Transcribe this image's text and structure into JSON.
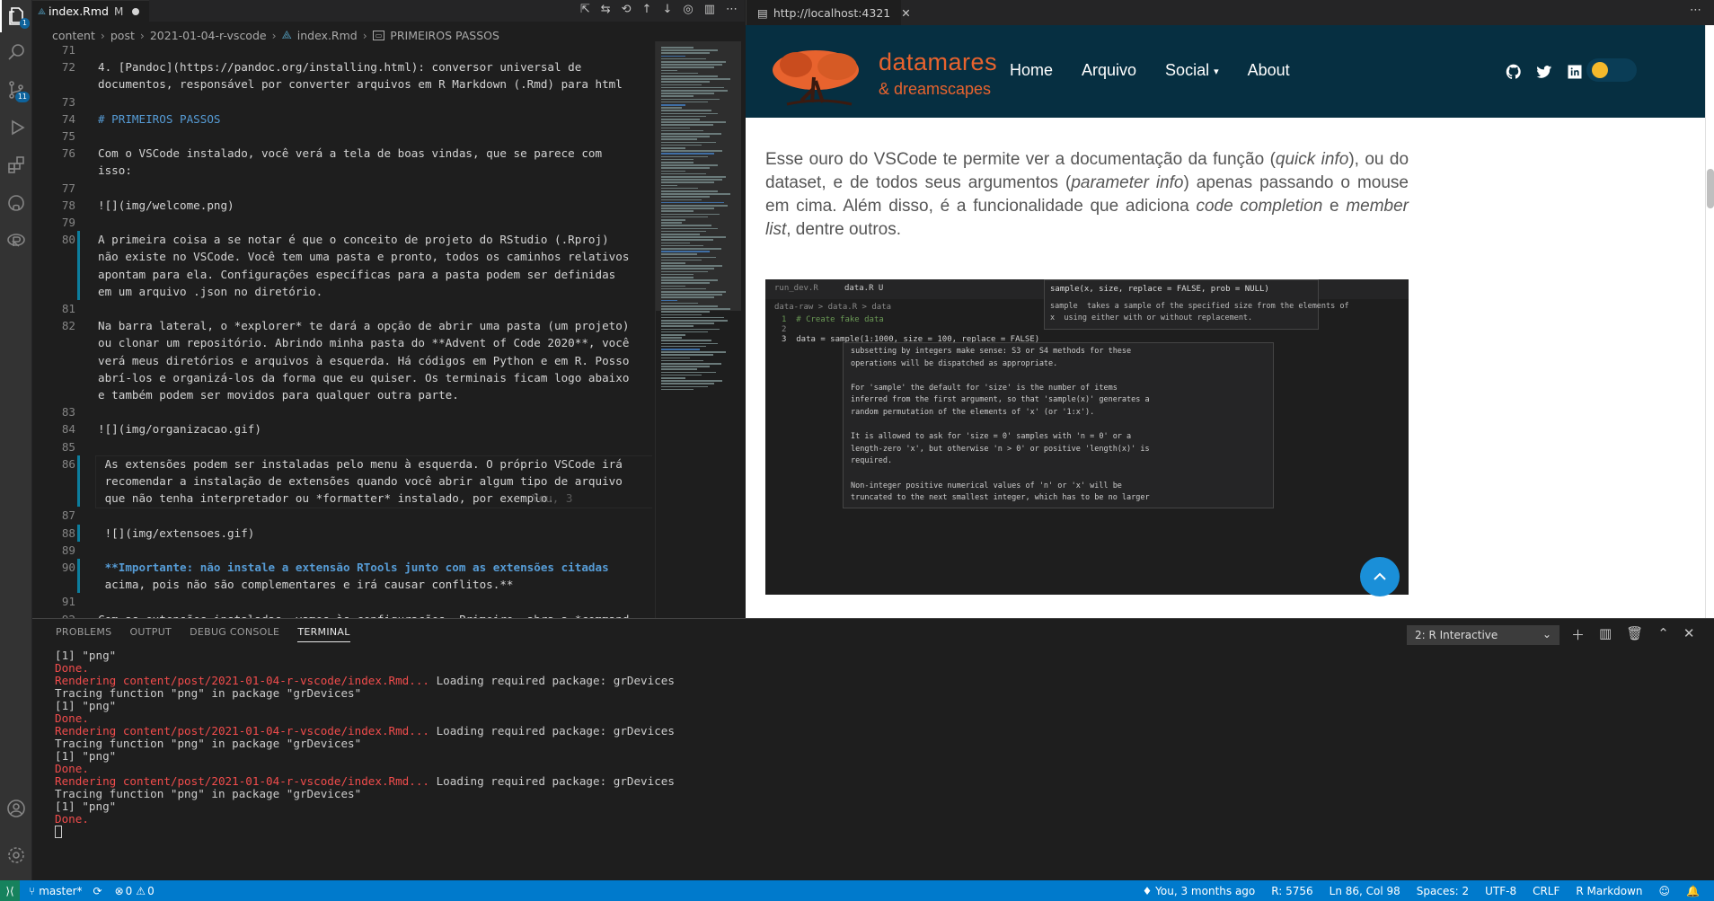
{
  "editor": {
    "tab_title": "index.Rmd",
    "tab_status": "M",
    "breadcrumb": [
      "content",
      "post",
      "2021-01-04-r-vscode",
      "index.Rmd",
      "PRIMEIROS PASSOS"
    ],
    "lines": [
      {
        "n": "71",
        "t": ""
      },
      {
        "n": "72",
        "t": "4. [Pandoc](https://pandoc.org/installing.html): conversor universal de"
      },
      {
        "n": "",
        "t": "documentos, responsável por converter arquivos em R Markdown (.Rmd) para html"
      },
      {
        "n": "73",
        "t": ""
      },
      {
        "n": "74",
        "t": "# PRIMEIROS PASSOS"
      },
      {
        "n": "75",
        "t": ""
      },
      {
        "n": "76",
        "t": "Com o VSCode instalado, você verá a tela de boas vindas, que se parece com"
      },
      {
        "n": "",
        "t": "isso:"
      },
      {
        "n": "77",
        "t": ""
      },
      {
        "n": "78",
        "t": "![](img/welcome.png)"
      },
      {
        "n": "79",
        "t": ""
      },
      {
        "n": "80",
        "t": "A primeira coisa a se notar é que o conceito de projeto do RStudio (.Rproj)"
      },
      {
        "n": "",
        "t": "não existe no VSCode. Você tem uma pasta e pronto, todos os caminhos relativos"
      },
      {
        "n": "",
        "t": "apontam para ela. Configurações específicas para a pasta podem ser definidas"
      },
      {
        "n": "",
        "t": "em um arquivo .json no diretório."
      },
      {
        "n": "81",
        "t": ""
      },
      {
        "n": "82",
        "t": "Na barra lateral, o *explorer* te dará a opção de abrir uma pasta (um projeto)"
      },
      {
        "n": "",
        "t": "ou clonar um repositório. Abrindo minha pasta do **Advent of Code 2020**, você"
      },
      {
        "n": "",
        "t": "verá meus diretórios e arquivos à esquerda. Há códigos em Python e em R. Posso"
      },
      {
        "n": "",
        "t": "abrí-los e organizá-los da forma que eu quiser. Os terminais ficam logo abaixo"
      },
      {
        "n": "",
        "t": "e também podem ser movidos para qualquer outra parte."
      },
      {
        "n": "83",
        "t": ""
      },
      {
        "n": "84",
        "t": "![](img/organizacao.gif)"
      },
      {
        "n": "85",
        "t": ""
      },
      {
        "n": "86",
        "t": " As extensões podem ser instaladas pelo menu à esquerda. O próprio VSCode irá"
      },
      {
        "n": "",
        "t": " recomendar a instalação de extensões quando você abrir algum tipo de arquivo"
      },
      {
        "n": "",
        "t": " que não tenha interpretador ou *formatter* instalado, por exemplo."
      },
      {
        "n": "87",
        "t": ""
      },
      {
        "n": "88",
        "t": " ![](img/extensoes.gif)"
      },
      {
        "n": "89",
        "t": ""
      },
      {
        "n": "90",
        "t": " **Importante: não instale a extensão RTools junto com as extensões citadas"
      },
      {
        "n": "",
        "t": " acima, pois não são complementares e irá causar conflitos.**"
      },
      {
        "n": "91",
        "t": ""
      },
      {
        "n": "92",
        "t": "Com as extensões instaladas, vamos às configurações. Primeiro, abra a *command"
      }
    ],
    "blame": "You, 3"
  },
  "preview": {
    "tab_title": "http://localhost:4321",
    "site": {
      "logo_line1": "datamares",
      "logo_line2": "& dreamscapes",
      "nav": [
        "Home",
        "Arquivo",
        "Social",
        "About"
      ]
    },
    "article": {
      "p1": "Esse ouro do VSCode te permite ver a documentação da função (",
      "i1": "quick info",
      "p2": "), ou do dataset, e de todos seus argumentos (",
      "i2": "parameter info",
      "p3": ") apenas passando o mouse em cima. Além disso, é a funcionalidade que adiciona ",
      "i3": "code completion",
      "p4": " e ",
      "i4": "member list",
      "p5": ", dentre outros."
    },
    "shot": {
      "tabs": [
        "run_dev.R",
        "data.R U"
      ],
      "crumb": "data-raw > data.R > data",
      "code": [
        "1  # Create fake data",
        "2",
        "3  data = sample(1:1000, size = 100, replace = FALSE)"
      ],
      "sig": "sample(x, size, replace = FALSE, prob = NULL)",
      "sig_doc1": "sample  takes a sample of the specified size from the elements of",
      "sig_doc2": "x  using either with or without replacement.",
      "doc": [
        "subsetting by integers make sense: S3 or S4 methods for these",
        "operations will be dispatched as appropriate.",
        "",
        "For 'sample' the default for 'size' is the number of items",
        "inferred from the first argument, so that 'sample(x)' generates a",
        "random permutation of the elements of 'x' (or '1:x').",
        "",
        "It is allowed to ask for 'size = 0' samples with 'n = 0' or a",
        "length-zero 'x', but otherwise 'n > 0' or positive 'length(x)' is",
        "required.",
        "",
        "Non-integer positive numerical values of 'n' or 'x' will be",
        "truncated to the next smallest integer, which has to be no larger"
      ]
    }
  },
  "panel": {
    "tabs": [
      "PROBLEMS",
      "OUTPUT",
      "DEBUG CONSOLE",
      "TERMINAL"
    ],
    "terminal_select": "2: R Interactive",
    "lines": [
      {
        "c": "w",
        "t": "[1] \"png\""
      },
      {
        "c": "r",
        "t": "Done."
      },
      {
        "c": "r",
        "t": "Rendering content/post/2021-01-04-r-vscode/index.Rmd...",
        "w": " Loading required package: grDevices"
      },
      {
        "c": "w",
        "t": "Tracing function \"png\" in package \"grDevices\""
      },
      {
        "c": "w",
        "t": "[1] \"png\""
      },
      {
        "c": "r",
        "t": "Done."
      },
      {
        "c": "r",
        "t": "Rendering content/post/2021-01-04-r-vscode/index.Rmd...",
        "w": " Loading required package: grDevices"
      },
      {
        "c": "w",
        "t": "Tracing function \"png\" in package \"grDevices\""
      },
      {
        "c": "w",
        "t": "[1] \"png\""
      },
      {
        "c": "r",
        "t": "Done."
      },
      {
        "c": "r",
        "t": "Rendering content/post/2021-01-04-r-vscode/index.Rmd...",
        "w": " Loading required package: grDevices"
      },
      {
        "c": "w",
        "t": "Tracing function \"png\" in package \"grDevices\""
      },
      {
        "c": "w",
        "t": "[1] \"png\""
      },
      {
        "c": "r",
        "t": "Done."
      }
    ]
  },
  "status": {
    "branch": "master*",
    "errors": "0",
    "warnings": "0",
    "blame": "You, 3 months ago",
    "r_pid": "R: 5756",
    "position": "Ln 86, Col 98",
    "spaces": "Spaces: 2",
    "encoding": "UTF-8",
    "eol": "CRLF",
    "language": "R Markdown"
  },
  "colors": {
    "accent": "#007acc",
    "site_nav": "#062f41",
    "logo": "#e8632e",
    "link": "#3794ff"
  }
}
